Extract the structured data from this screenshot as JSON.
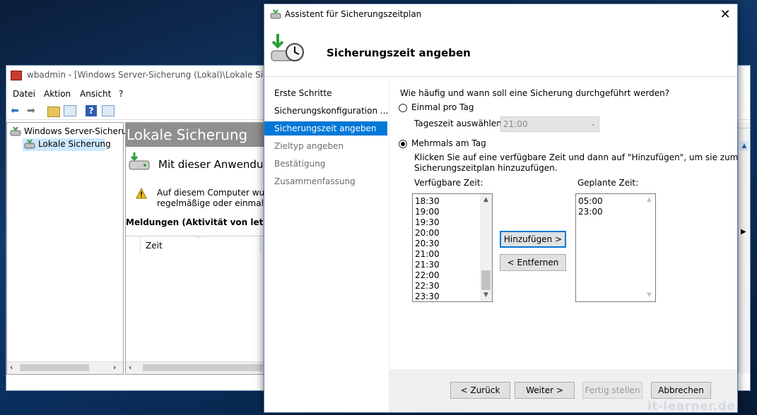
{
  "background_window": {
    "title": "wbadmin - [Windows Server-Sicherung (Lokal)\\Lokale Sicherun",
    "menu": [
      "Datei",
      "Aktion",
      "Ansicht",
      "?"
    ],
    "tree": {
      "root": "Windows Server-Sicherun",
      "child": "Lokale Sicherung"
    },
    "main": {
      "header": "Lokale Sicherung",
      "subtitle": "Mit dieser Anwendun",
      "warning_line1": "Auf diesem Computer wurde",
      "warning_line2": "regelmäßige oder einmalige",
      "messages_heading": "Meldungen (Aktivität von letzter W",
      "column_time": "Zeit"
    }
  },
  "dialog": {
    "title": "Assistent für Sicherungszeitplan",
    "close_glyph": "✕",
    "banner_title": "Sicherungszeit angeben",
    "steps": [
      {
        "label": "Erste Schritte",
        "state": "normal"
      },
      {
        "label": "Sicherungskonfiguration ...",
        "state": "normal"
      },
      {
        "label": "Sicherungszeit angeben",
        "state": "active"
      },
      {
        "label": "Zieltyp angeben",
        "state": "dim"
      },
      {
        "label": "Bestätigung",
        "state": "dim"
      },
      {
        "label": "Zusammenfassung",
        "state": "dim"
      }
    ],
    "question": "Wie häufig und wann soll eine Sicherung durchgeführt werden?",
    "option_once": {
      "label": "Einmal pro Tag",
      "checked": false
    },
    "time_of_day_label": "Tageszeit auswählen:",
    "time_of_day_value": "21:00",
    "option_multiple": {
      "label": "Mehrmals am Tag",
      "checked": true
    },
    "instruction_line1": "Klicken Sie auf eine verfügbare Zeit und dann auf \"Hinzufügen\", um sie zum",
    "instruction_line2": "Sicherungszeitplan hinzuzufügen.",
    "available_label": "Verfügbare Zeit:",
    "available_times": [
      "18:30",
      "19:00",
      "19:30",
      "20:00",
      "20:30",
      "21:00",
      "21:30",
      "22:00",
      "22:30",
      "23:30"
    ],
    "scheduled_label": "Geplante Zeit:",
    "scheduled_times": [
      "05:00",
      "23:00"
    ],
    "add_button": "Hinzufügen >",
    "remove_button": "< Entfernen",
    "back_button": "< Zurück",
    "next_button": "Weiter >",
    "finish_button": "Fertig stellen",
    "cancel_button": "Abbrechen"
  },
  "watermark": "it-learner.de",
  "colors": {
    "selection_blue": "#0078d7",
    "window_border": "#5a7fb0",
    "header_gray": "#8f8f8f"
  }
}
